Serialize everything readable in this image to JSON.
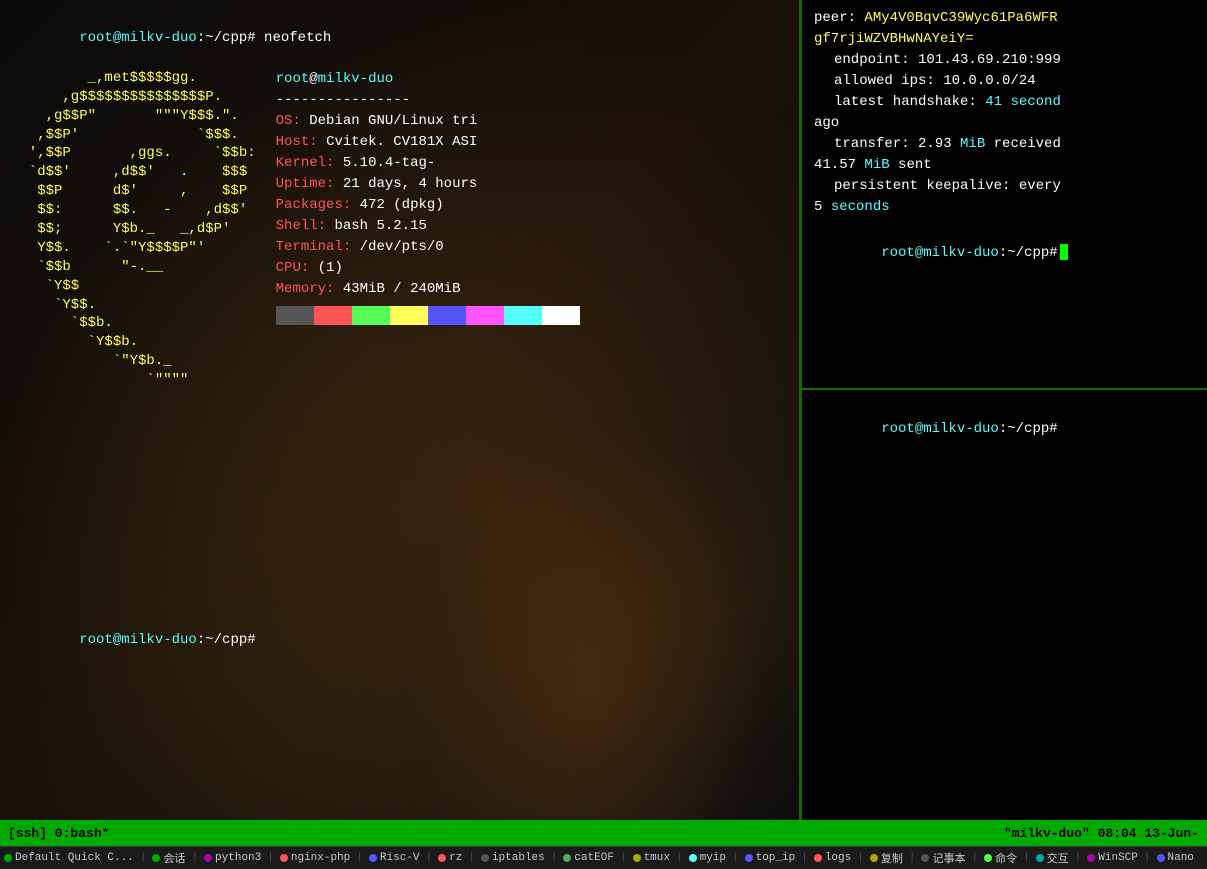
{
  "terminal": {
    "title": "milkv-duo",
    "time": "08:04 13-Jun-",
    "status_bar": "[ssh] 0:bash*",
    "hostname_label": "root@milkv-duo",
    "cwd": "~/cpp#"
  },
  "left_pane": {
    "prompt_top": "root@milkv-duo:~/cpp# neofetch",
    "ascii_art": [
      "         _,met$$$$$gg.",
      "      ,g$$$$$$$$$$$$$$$P.",
      "    ,g$$P\"       \"\"\"Y$$$.\".  ",
      "   ,$$P'              `$$$.  ",
      "  ',$$P       ,ggs.     `$$b:",
      "  `d$$'     ,d$$'   .    $$$",
      "   $$P      d$'     ,    $$P ",
      "   $$:      $$.   -    ,d$$' ",
      "   $$;      Y$b._   _,d$P'   ",
      "   Y$$.    `.`\"Y$$$$P\"'     ",
      "   `$$b      \"-.__           ",
      "    `Y$$                     ",
      "     `Y$$.                   ",
      "       `$$b.                 ",
      "         `Y$$b.              ",
      "            `\"Y$b._         ",
      "                `\"\"\"\"      "
    ],
    "neofetch_info": {
      "user_host": "root@milkv-duo",
      "separator": "----------------",
      "os_label": "OS:",
      "os_value": "Debian GNU/Linux tri",
      "host_label": "Host:",
      "host_value": "Cvitek. CV181X ASI",
      "kernel_label": "Kernel:",
      "kernel_value": "5.10.4-tag-",
      "uptime_label": "Uptime:",
      "uptime_value": "21 days, 4 hours",
      "packages_label": "Packages:",
      "packages_value": "472 (dpkg)",
      "shell_label": "Shell:",
      "shell_value": "bash 5.2.15",
      "terminal_label": "Terminal:",
      "terminal_value": "/dev/pts/0",
      "cpu_label": "CPU:",
      "cpu_value": "(1)",
      "memory_label": "Memory:",
      "memory_value": "43MiB / 240MiB"
    },
    "prompt_bottom": "root@milkv-duo:~/cpp#"
  },
  "right_pane": {
    "top": {
      "peer_label": "peer:",
      "peer_value": "AMy4V0BqvC39Wyc61Pa6WFR",
      "peer_value2": "gf7rjiWZVBHwNAYeiY=",
      "endpoint_label": "endpoint:",
      "endpoint_value": "101.43.69.210:999",
      "allowed_ips_label": "allowed ips:",
      "allowed_ips_value": "10.0.0.0/24",
      "latest_handshake_label": "latest handshake:",
      "latest_handshake_value": "41 second",
      "ago": "ago",
      "transfer_label": "transfer:",
      "transfer_value1": "2.93",
      "transfer_mib1": "MiB",
      "transfer_received": "received",
      "transfer_value2": "41.57",
      "transfer_mib2": "MiB",
      "transfer_sent": "sent",
      "persistent_label": "persistent keepalive:",
      "persistent_every": "every",
      "persistent_seconds": "5 seconds",
      "prompt1": "root@milkv-duo:~/cpp#"
    },
    "bottom": {
      "prompt": "root@milkv-duo:~/cpp#"
    }
  },
  "status_bar": {
    "left": "[ssh] 0:bash*",
    "right": "\"milkv-duo\" 08:04 13-Jun-"
  },
  "tab_bar": {
    "items": [
      {
        "id": "default-quick",
        "label": "Default Quick C...",
        "color": "#00aa00"
      },
      {
        "id": "huihua",
        "label": "会话",
        "color": "#00aa00"
      },
      {
        "id": "python3",
        "label": "python3",
        "color": "#aa00aa"
      },
      {
        "id": "nginx-php",
        "label": "nginx-php",
        "color": "#ff5555"
      },
      {
        "id": "risc-v",
        "label": "Risc-V",
        "color": "#5555ff"
      },
      {
        "id": "rz",
        "label": "rz",
        "color": "#ff5555"
      },
      {
        "id": "iptables",
        "label": "iptables",
        "color": "#555555"
      },
      {
        "id": "cateof",
        "label": "catEOF",
        "color": "#55aa55"
      },
      {
        "id": "tmux",
        "label": "tmux",
        "color": "#aaaa00"
      },
      {
        "id": "myip",
        "label": "myip",
        "color": "#55ffff"
      },
      {
        "id": "top-ip",
        "label": "top_ip",
        "color": "#5555ff"
      },
      {
        "id": "logs",
        "label": "logs",
        "color": "#ff5555"
      },
      {
        "id": "fuzhui",
        "label": "复制",
        "color": "#aaaa00"
      },
      {
        "id": "jiben",
        "label": "记事本",
        "color": "#555555"
      },
      {
        "id": "lingling",
        "label": "命令",
        "color": "#55ff55"
      },
      {
        "id": "jiaohu",
        "label": "交互",
        "color": "#00aaaa"
      },
      {
        "id": "winscp",
        "label": "WinSCP",
        "color": "#aa00aa"
      },
      {
        "id": "nano",
        "label": "Nano",
        "color": "#5555ff"
      }
    ]
  }
}
